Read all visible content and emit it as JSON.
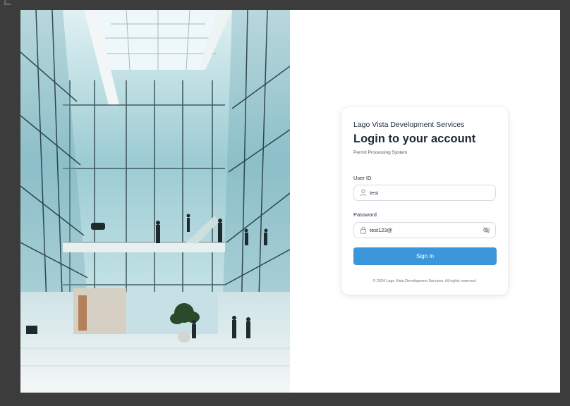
{
  "login": {
    "org_name": "Lago Vista Development Services",
    "heading": "Login to your account",
    "subtitle": "Permit Processing System",
    "userid_label": "User ID",
    "userid_value": "test",
    "password_label": "Password",
    "password_value": "test123@",
    "submit_label": "Sign In",
    "copyright": "© 2024 Lago Vista Development Services. All rights reserved."
  },
  "icons": {
    "user": "user-icon",
    "lock": "lock-icon",
    "visibility": "eye-off-icon"
  },
  "colors": {
    "primary": "#3b97d9",
    "text": "#1e2a38",
    "backdrop": "#3c3c3c"
  }
}
